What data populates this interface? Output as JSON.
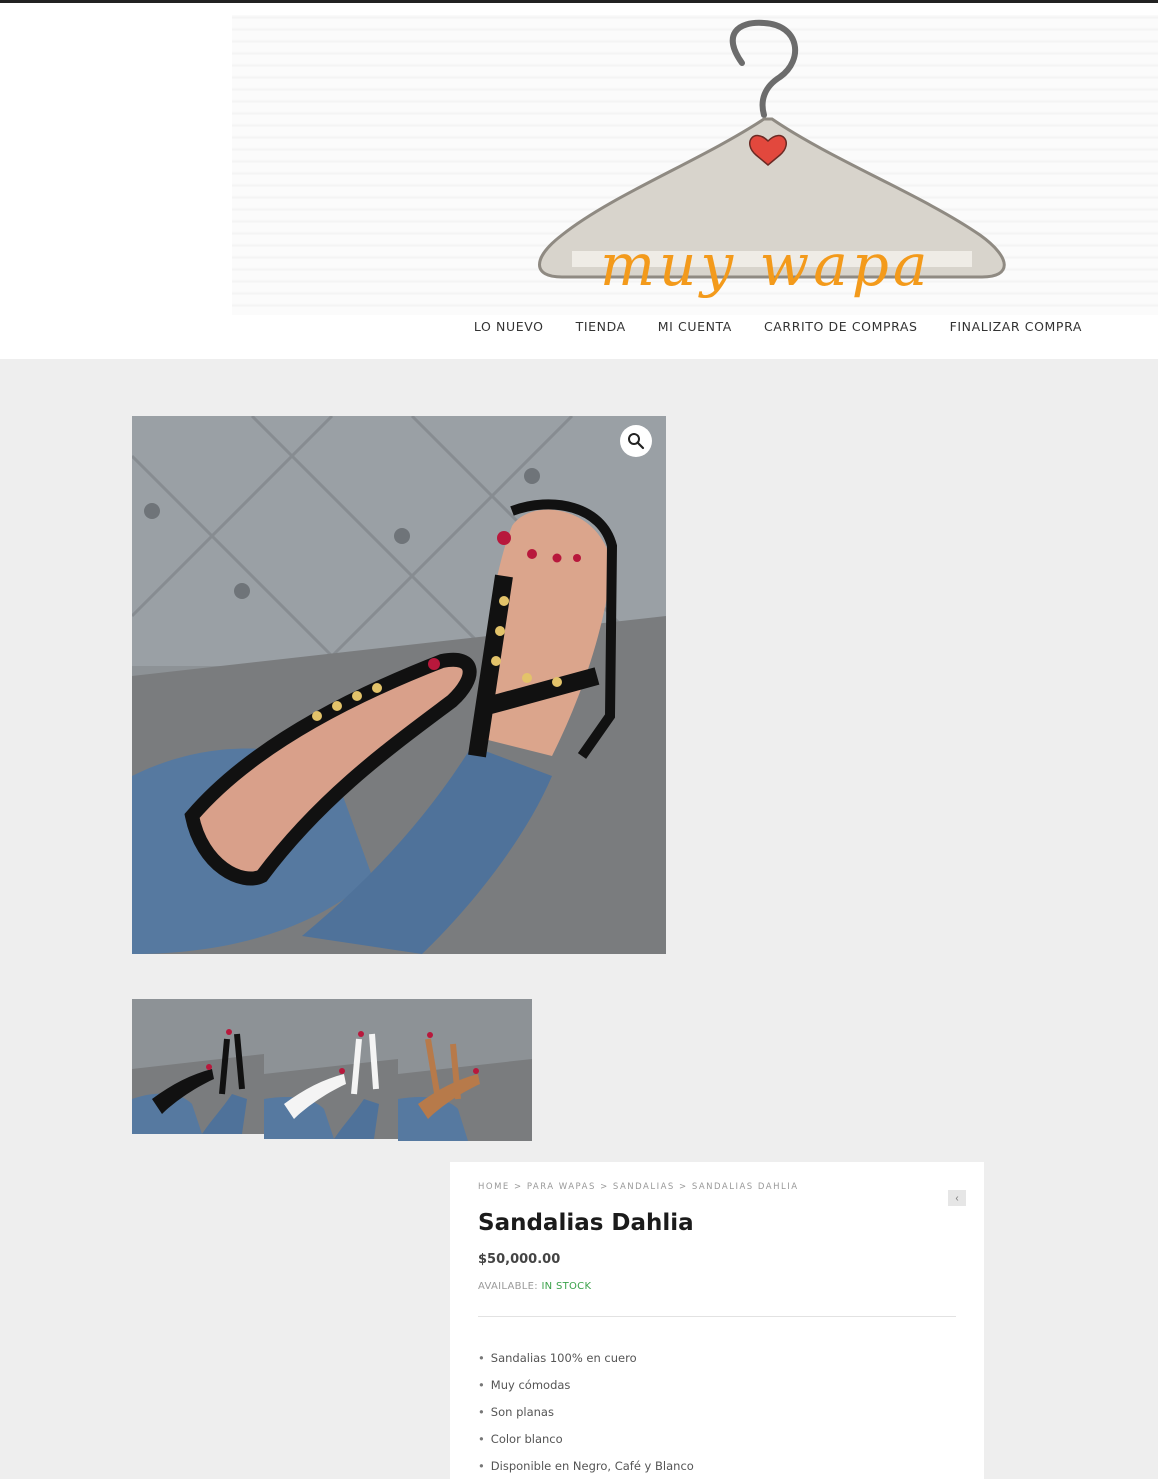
{
  "brand": {
    "name": "muy wapa",
    "accent_color": "#f39a1b"
  },
  "nav": [
    {
      "label": "LO NUEVO"
    },
    {
      "label": "TIENDA"
    },
    {
      "label": "MI CUENTA"
    },
    {
      "label": "CARRITO DE COMPRAS"
    },
    {
      "label": "FINALIZAR COMPRA"
    }
  ],
  "gallery": {
    "zoom_icon": "magnifier-icon",
    "thumbnails": [
      {
        "color": "Negro"
      },
      {
        "color": "Blanco"
      },
      {
        "color": "Café"
      }
    ]
  },
  "product": {
    "breadcrumb": [
      "HOME",
      "PARA WAPAS",
      "SANDALIAS",
      "SANDALIAS DAHLIA"
    ],
    "breadcrumb_separator": ">",
    "prev_icon": "chevron-left-icon",
    "title": "Sandalias Dahlia",
    "price": "$50,000.00",
    "availability_label": "AVAILABLE:",
    "availability_value": "IN STOCK",
    "features": [
      "Sandalias 100% en cuero",
      "Muy cómodas",
      "Son planas",
      "Color blanco",
      "Disponible en Negro, Café y Blanco"
    ]
  }
}
